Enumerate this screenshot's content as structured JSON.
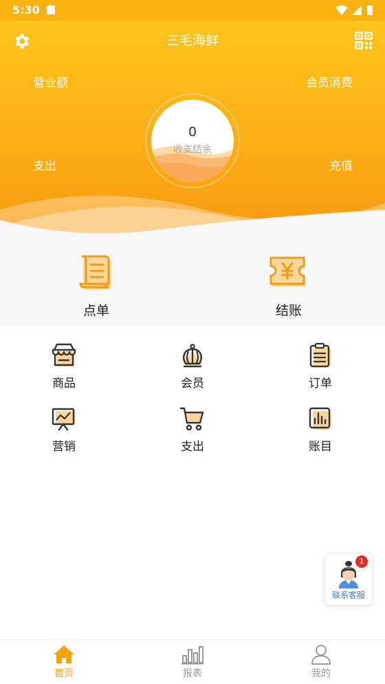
{
  "status_bar": {
    "time": "5:30"
  },
  "header": {
    "title": "三毛海鲜"
  },
  "stats": {
    "revenue_label": "营业额",
    "member_spend_label": "会员消费",
    "expense_label": "支出",
    "recharge_label": "充值"
  },
  "balance": {
    "value": "0",
    "label": "收支结余"
  },
  "quick_actions": [
    {
      "label": "点单",
      "icon": "receipt-icon"
    },
    {
      "label": "结账",
      "icon": "yen-ticket-icon"
    }
  ],
  "menu": [
    {
      "label": "商品",
      "icon": "store-icon"
    },
    {
      "label": "会员",
      "icon": "crown-icon"
    },
    {
      "label": "订单",
      "icon": "clipboard-icon"
    },
    {
      "label": "营销",
      "icon": "presentation-chart-icon"
    },
    {
      "label": "支出",
      "icon": "cart-icon"
    },
    {
      "label": "账目",
      "icon": "bar-chart-icon"
    }
  ],
  "customer_service": {
    "label": "联系客服",
    "badge": "1"
  },
  "tabs": [
    {
      "label": "首页",
      "icon": "home-icon",
      "active": true
    },
    {
      "label": "报表",
      "icon": "report-icon",
      "active": false
    },
    {
      "label": "我的",
      "icon": "user-icon",
      "active": false
    }
  ],
  "colors": {
    "accent": "#f8a10f",
    "hero_top": "#fdc519",
    "hero_bottom": "#f8980f",
    "active_tab": "#f5a30c",
    "icon_accent": "#fbb34a"
  }
}
